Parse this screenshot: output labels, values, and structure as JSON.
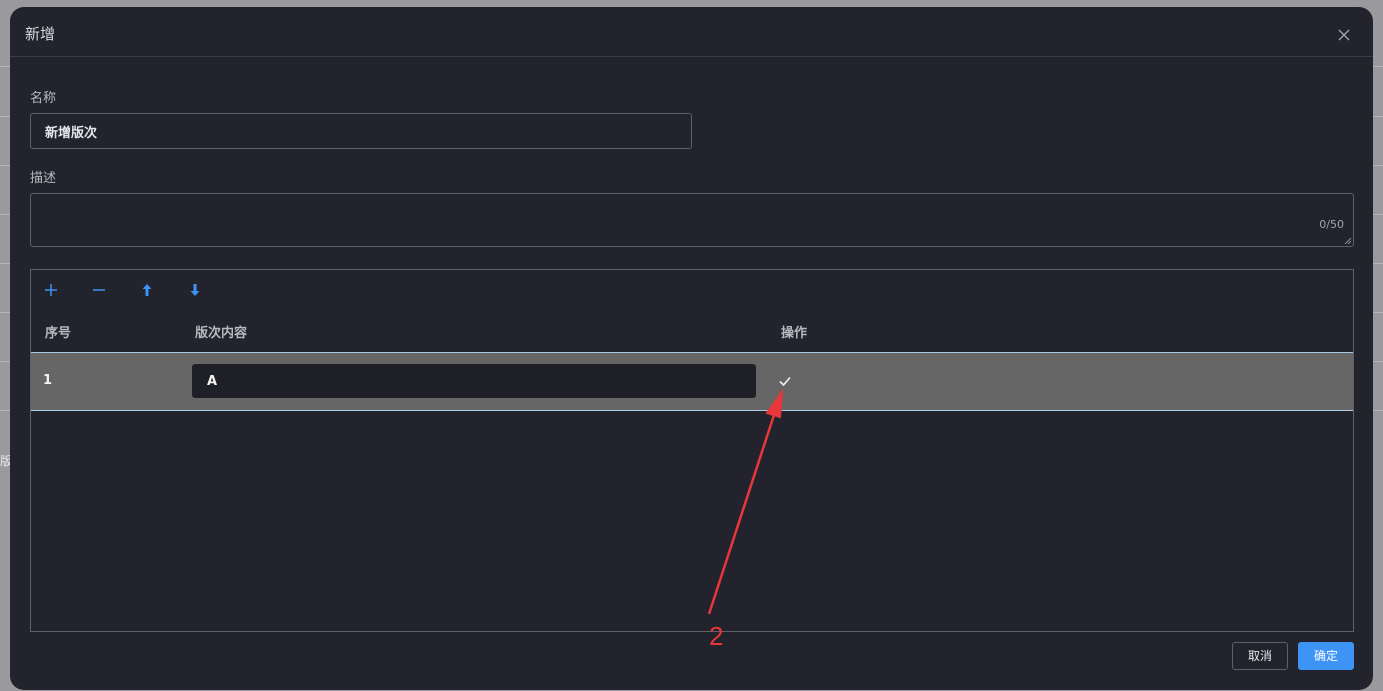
{
  "background": {
    "fragment_text": "版"
  },
  "dialog": {
    "title": "新增",
    "close_icon": "close-icon"
  },
  "form": {
    "name_label": "名称",
    "name_value": "新增版次",
    "description_label": "描述",
    "description_value": "",
    "description_counter": "0/50"
  },
  "table": {
    "toolbar": [
      {
        "icon": "plus-icon"
      },
      {
        "icon": "minus-icon"
      },
      {
        "icon": "arrow-up-icon"
      },
      {
        "icon": "arrow-down-icon"
      }
    ],
    "headers": [
      "序号",
      "版次内容",
      "操作"
    ],
    "rows": [
      {
        "index": "1",
        "content": "A",
        "action_icon": "check-icon"
      }
    ]
  },
  "footer": {
    "cancel_label": "取消",
    "confirm_label": "确定"
  },
  "annotation": {
    "label": "2",
    "color": "#e8363a"
  },
  "colors": {
    "accent": "#3d93f6",
    "dialog_bg": "#23232d",
    "selected_row_bg": "#666666"
  }
}
